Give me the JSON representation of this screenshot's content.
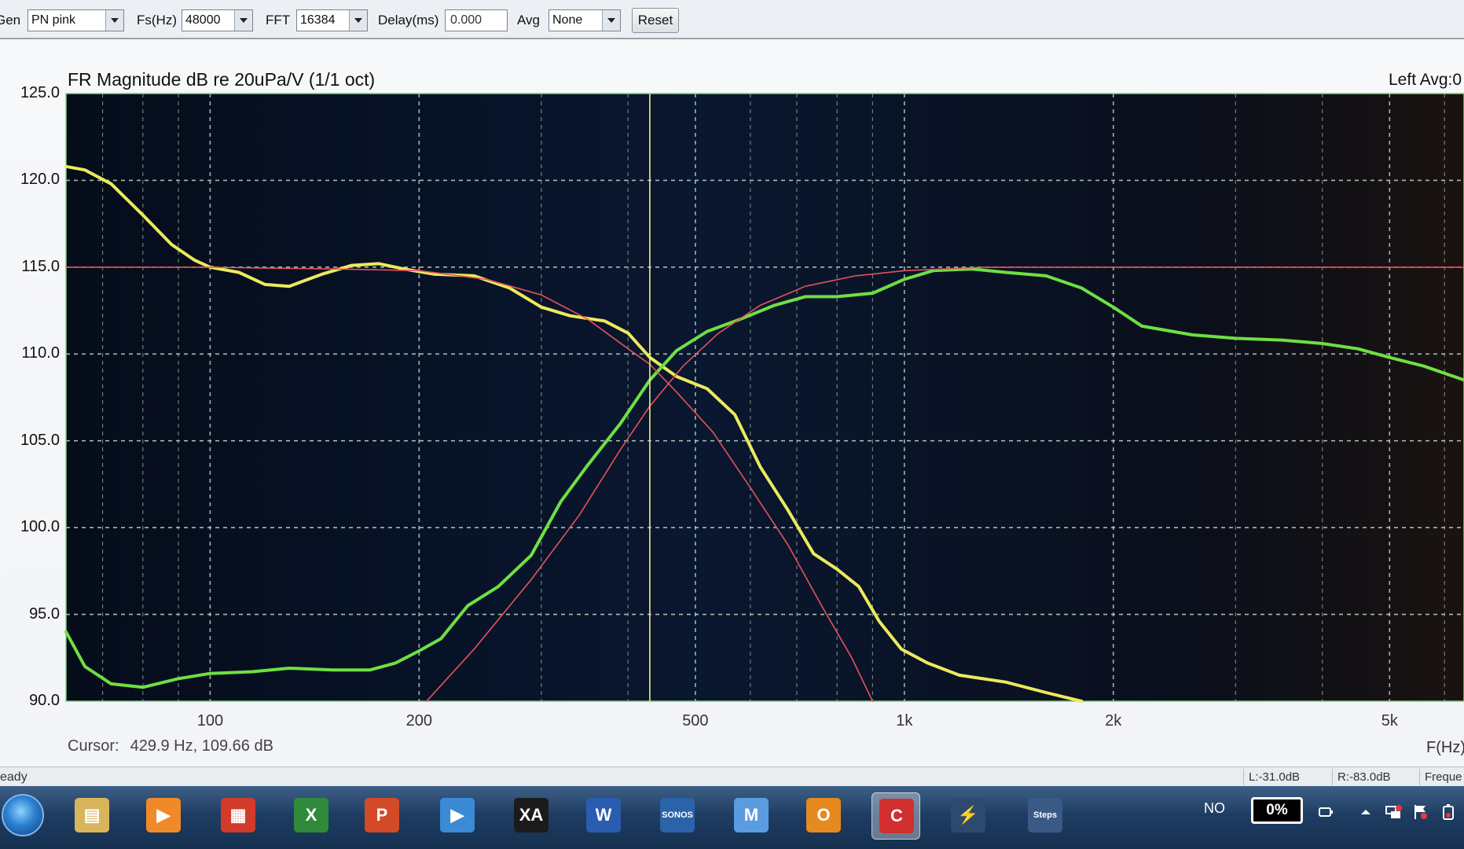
{
  "toolbar": {
    "gen_label": "Gen",
    "gen_value": "PN pink",
    "fs_label": "Fs(Hz)",
    "fs_value": "48000",
    "fft_label": "FFT",
    "fft_value": "16384",
    "delay_label": "Delay(ms)",
    "delay_value": "0.000",
    "avg_label": "Avg",
    "avg_value": "None",
    "reset_label": "Reset"
  },
  "graph": {
    "title": "FR Magnitude dB re 20uPa/V (1/1 oct)",
    "channel_text": "Left  Avg:0",
    "freq_unit": "F(Hz)",
    "cursor_label": "Cursor:",
    "cursor_value": "429.9 Hz, 109.66 dB"
  },
  "chart_data": {
    "type": "line",
    "title": "FR Magnitude dB re 20uPa/V (1/1 oct)",
    "xlabel": "F(Hz)",
    "ylabel": "",
    "x_scale": "log",
    "xlim": [
      62,
      6400
    ],
    "ylim": [
      90,
      125
    ],
    "x_ticks": [
      100,
      200,
      500,
      1000,
      2000,
      5000
    ],
    "x_tick_labels": [
      "100",
      "200",
      "500",
      "1k",
      "2k",
      "5k"
    ],
    "y_ticks": [
      90,
      95,
      100,
      105,
      110,
      115,
      120,
      125
    ],
    "y_tick_labels": [
      "90.0",
      "95.0",
      "100.0",
      "105.0",
      "110.0",
      "115.0",
      "120.0",
      "125.0"
    ],
    "grid": true,
    "cursor": {
      "x": 429.9,
      "y": 109.66
    },
    "colors": {
      "background": "#07101f",
      "grid": "#8fa59a",
      "yellow": "#ecea5c",
      "green": "#6ee043",
      "red": "#e5535a",
      "cursor": "#f2eb86"
    },
    "series": [
      {
        "color": "yellow",
        "points": [
          [
            62,
            120.8
          ],
          [
            66,
            120.6
          ],
          [
            72,
            119.8
          ],
          [
            80,
            118.0
          ],
          [
            88,
            116.3
          ],
          [
            95,
            115.4
          ],
          [
            100,
            115.0
          ],
          [
            110,
            114.7
          ],
          [
            120,
            114.0
          ],
          [
            130,
            113.9
          ],
          [
            145,
            114.6
          ],
          [
            160,
            115.1
          ],
          [
            175,
            115.2
          ],
          [
            190,
            114.9
          ],
          [
            210,
            114.6
          ],
          [
            240,
            114.5
          ],
          [
            270,
            113.8
          ],
          [
            300,
            112.7
          ],
          [
            330,
            112.2
          ],
          [
            370,
            111.9
          ],
          [
            400,
            111.2
          ],
          [
            430,
            109.8
          ],
          [
            470,
            108.7
          ],
          [
            520,
            108.0
          ],
          [
            570,
            106.5
          ],
          [
            620,
            103.5
          ],
          [
            680,
            101.0
          ],
          [
            740,
            98.5
          ],
          [
            800,
            97.6
          ],
          [
            860,
            96.6
          ],
          [
            920,
            94.6
          ],
          [
            990,
            93.0
          ],
          [
            1080,
            92.2
          ],
          [
            1200,
            91.5
          ],
          [
            1400,
            91.1
          ],
          [
            1600,
            90.5
          ],
          [
            1800,
            90.0
          ]
        ]
      },
      {
        "color": "green",
        "points": [
          [
            62,
            94.0
          ],
          [
            66,
            92.0
          ],
          [
            72,
            91.0
          ],
          [
            80,
            90.8
          ],
          [
            90,
            91.3
          ],
          [
            100,
            91.6
          ],
          [
            115,
            91.7
          ],
          [
            130,
            91.9
          ],
          [
            150,
            91.8
          ],
          [
            170,
            91.8
          ],
          [
            185,
            92.2
          ],
          [
            200,
            92.9
          ],
          [
            215,
            93.6
          ],
          [
            235,
            95.5
          ],
          [
            260,
            96.6
          ],
          [
            290,
            98.4
          ],
          [
            320,
            101.5
          ],
          [
            350,
            103.6
          ],
          [
            390,
            106.0
          ],
          [
            430,
            108.5
          ],
          [
            470,
            110.2
          ],
          [
            520,
            111.3
          ],
          [
            580,
            112.0
          ],
          [
            650,
            112.8
          ],
          [
            720,
            113.3
          ],
          [
            800,
            113.3
          ],
          [
            900,
            113.5
          ],
          [
            1000,
            114.3
          ],
          [
            1100,
            114.8
          ],
          [
            1250,
            114.9
          ],
          [
            1400,
            114.7
          ],
          [
            1600,
            114.5
          ],
          [
            1800,
            113.8
          ],
          [
            2000,
            112.7
          ],
          [
            2200,
            111.6
          ],
          [
            2600,
            111.1
          ],
          [
            3000,
            110.9
          ],
          [
            3500,
            110.8
          ],
          [
            4000,
            110.6
          ],
          [
            4500,
            110.3
          ],
          [
            5000,
            109.8
          ],
          [
            5600,
            109.3
          ],
          [
            6400,
            108.5
          ]
        ]
      },
      {
        "color": "red",
        "points": [
          [
            62,
            115.0
          ],
          [
            100,
            115.0
          ],
          [
            150,
            114.9
          ],
          [
            200,
            114.8
          ],
          [
            250,
            114.3
          ],
          [
            300,
            113.4
          ],
          [
            350,
            112.0
          ],
          [
            400,
            110.3
          ],
          [
            430,
            109.4
          ],
          [
            470,
            107.8
          ],
          [
            530,
            105.5
          ],
          [
            600,
            102.3
          ],
          [
            680,
            99.0
          ],
          [
            760,
            95.5
          ],
          [
            840,
            92.5
          ],
          [
            900,
            90.0
          ]
        ]
      },
      {
        "color": "red",
        "points": [
          [
            205,
            90.0
          ],
          [
            240,
            93.0
          ],
          [
            290,
            97.0
          ],
          [
            340,
            100.7
          ],
          [
            390,
            104.5
          ],
          [
            430,
            107.0
          ],
          [
            480,
            109.3
          ],
          [
            540,
            111.2
          ],
          [
            620,
            112.8
          ],
          [
            720,
            113.9
          ],
          [
            850,
            114.5
          ],
          [
            1000,
            114.8
          ],
          [
            1300,
            115.0
          ],
          [
            2000,
            115.0
          ],
          [
            6400,
            115.0
          ]
        ]
      }
    ]
  },
  "status": {
    "ready_text": "eady",
    "left_level": "L:-31.0dB",
    "right_level": "R:-83.0dB",
    "freq_short": "Freque"
  },
  "taskbar": {
    "apps": [
      {
        "icon": "file-explorer-icon",
        "glyph": "▤",
        "color": "#d9b45a"
      },
      {
        "icon": "media-player-icon",
        "glyph": "▶",
        "color": "#f08a28"
      },
      {
        "icon": "grid-app-icon",
        "glyph": "▦",
        "color": "#d23b2b"
      },
      {
        "icon": "excel-icon",
        "glyph": "X",
        "color": "#2f8a3c"
      },
      {
        "icon": "powerpoint-icon",
        "glyph": "P",
        "color": "#d24a26"
      },
      {
        "icon": "windows-media-player-icon",
        "glyph": "▶",
        "color": "#3a8ad6"
      },
      {
        "icon": "xa-app-icon",
        "glyph": "XA",
        "color": "#1b1b1b"
      },
      {
        "icon": "word-icon",
        "glyph": "W",
        "color": "#2a5db0"
      },
      {
        "icon": "sonos-icon",
        "glyph": "SONOS",
        "color": "#2a63a8"
      },
      {
        "icon": "m-app-icon",
        "glyph": "M",
        "color": "#5b9be0"
      },
      {
        "icon": "outlook-icon",
        "glyph": "O",
        "color": "#e48a1e"
      },
      {
        "icon": "refresh-app-icon",
        "glyph": "C",
        "color": "#d22f2f"
      },
      {
        "icon": "lightning-app-icon",
        "glyph": "⚡",
        "color": "#2b4a6e"
      },
      {
        "icon": "steps-app-icon",
        "glyph": "Steps",
        "color": "#3a5a86"
      }
    ],
    "language": "NO",
    "battery": "0%"
  }
}
